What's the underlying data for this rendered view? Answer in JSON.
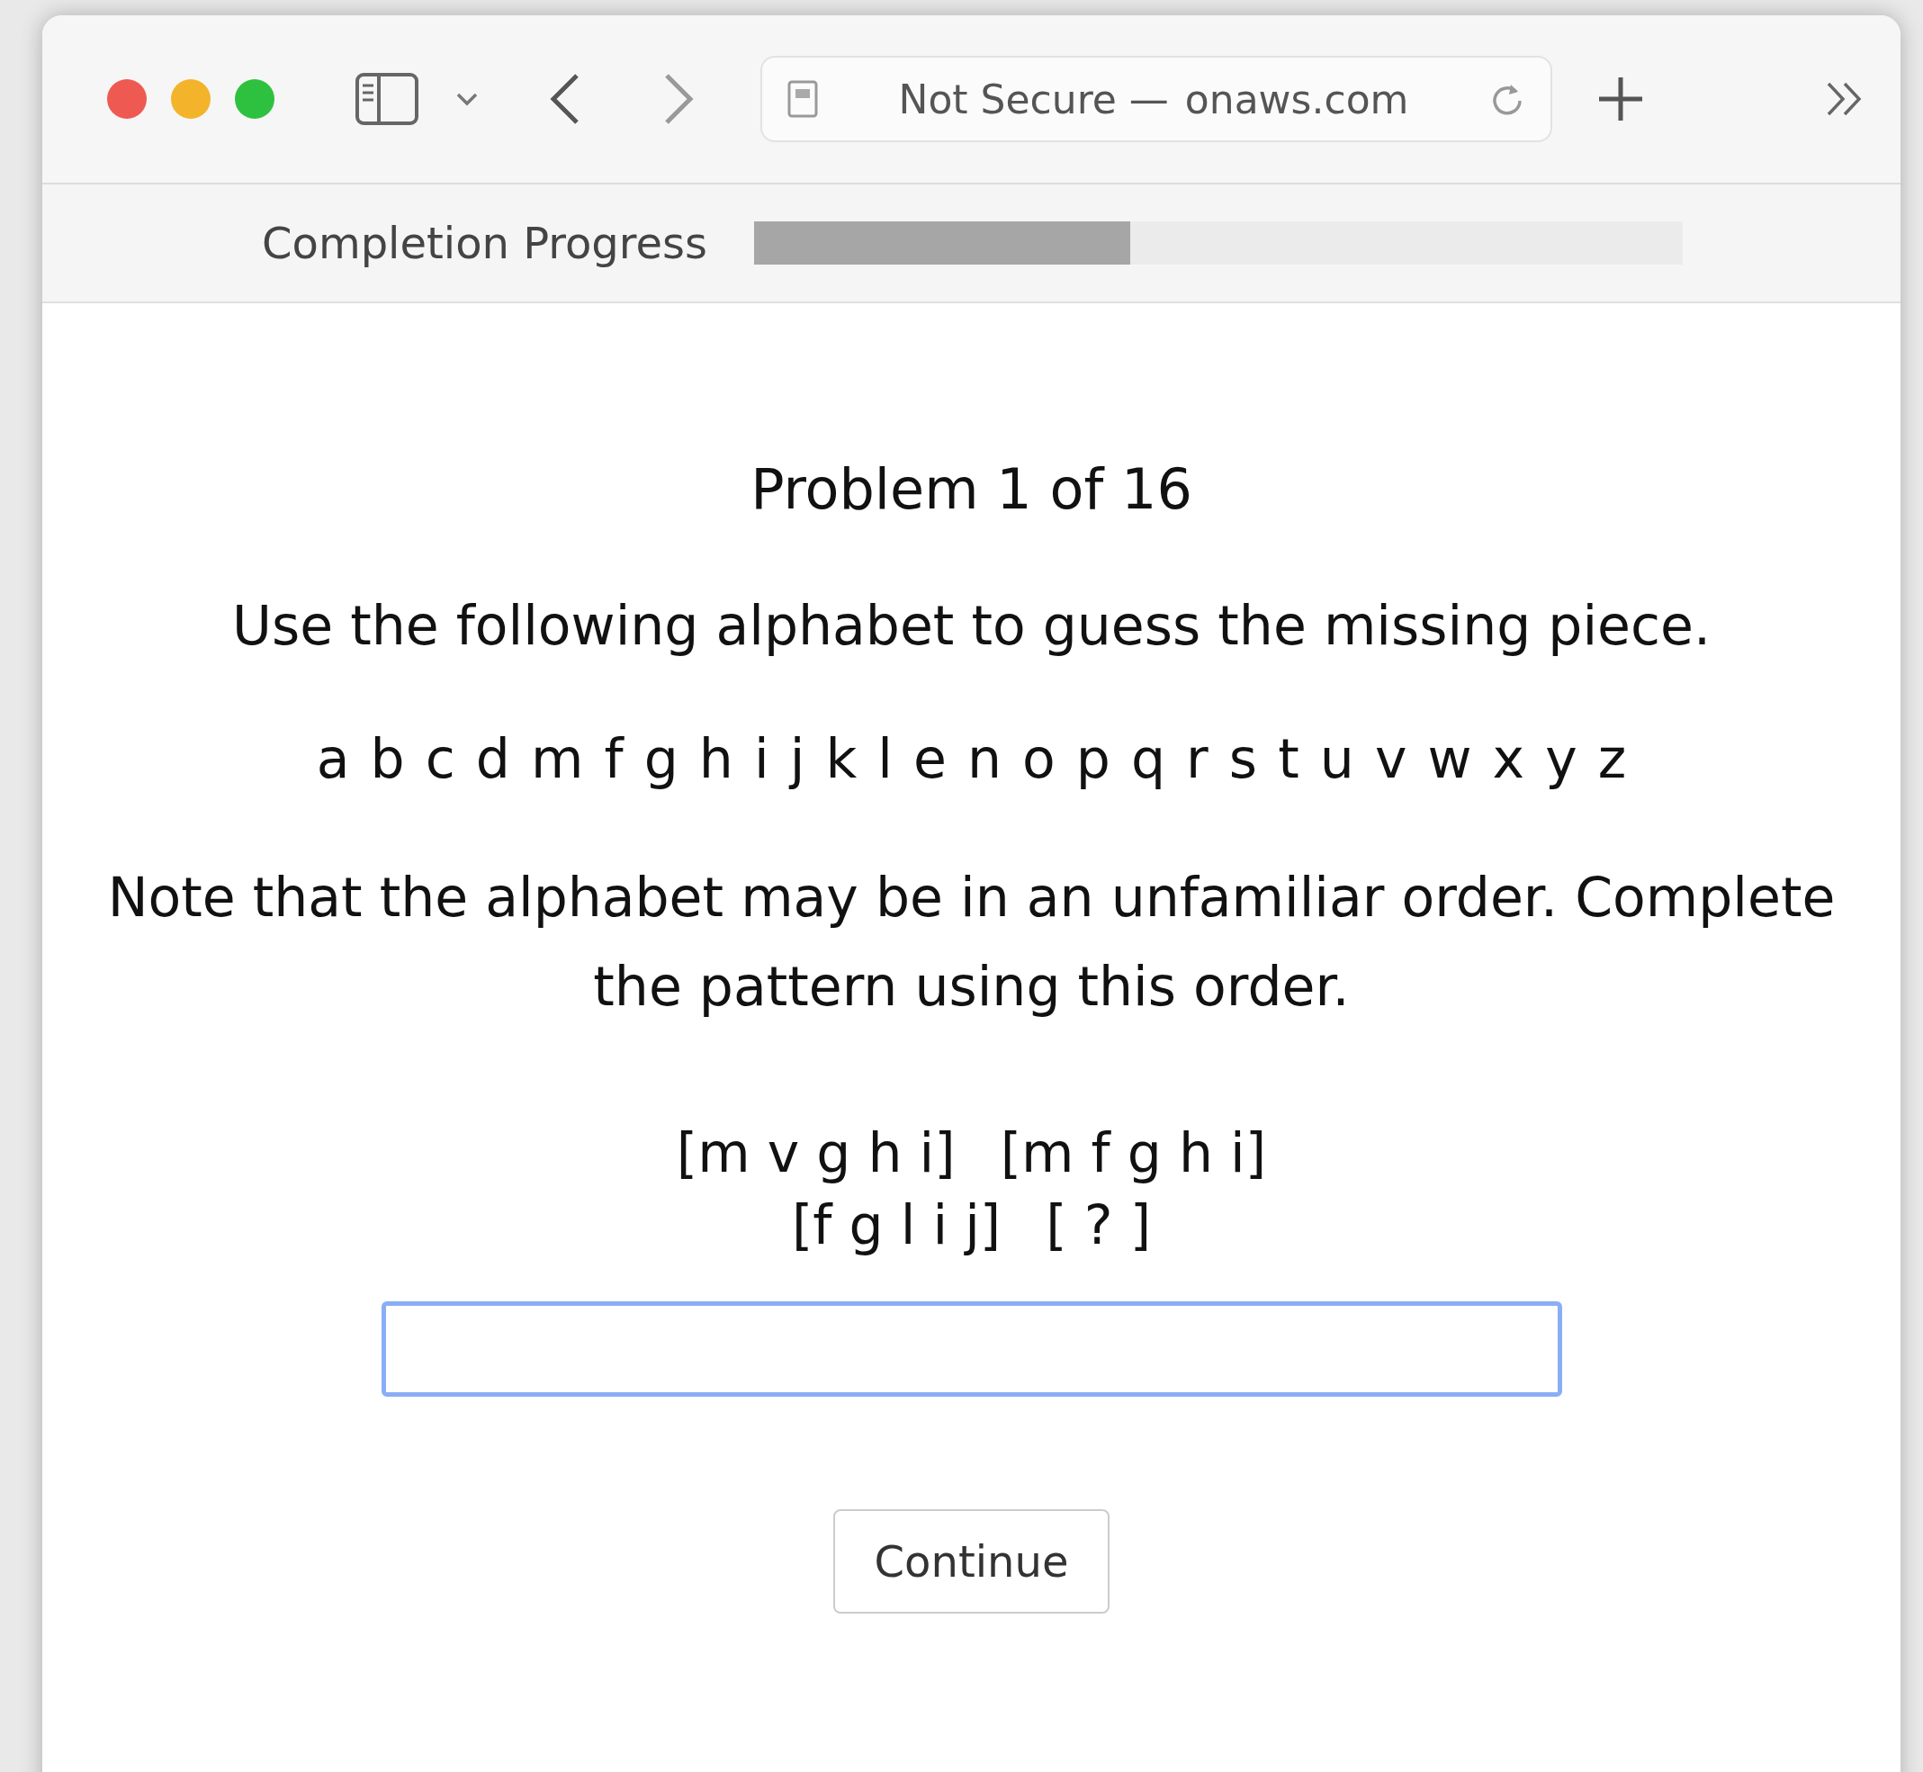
{
  "browser": {
    "address_prefix": "Not Secure —",
    "address_domain": "onaws.com"
  },
  "progress": {
    "label": "Completion Progress",
    "level": 0.405
  },
  "problem": {
    "title": "Problem 1 of 16",
    "instruction": "Use the following alphabet to guess the missing piece.",
    "alphabet": "a b c d m f g h i j k l e n o p q r s t u v w x y z",
    "note": "Note that the alphabet may be in an unfamiliar order. Complete the pattern using this order.",
    "pattern_rows": [
      [
        "[m v g h i]",
        "[m f g h i]"
      ],
      [
        "[f g l i j]",
        "[ ? ]"
      ]
    ]
  },
  "answer": {
    "focused": true
  },
  "buttons": [
    "Continue"
  ]
}
